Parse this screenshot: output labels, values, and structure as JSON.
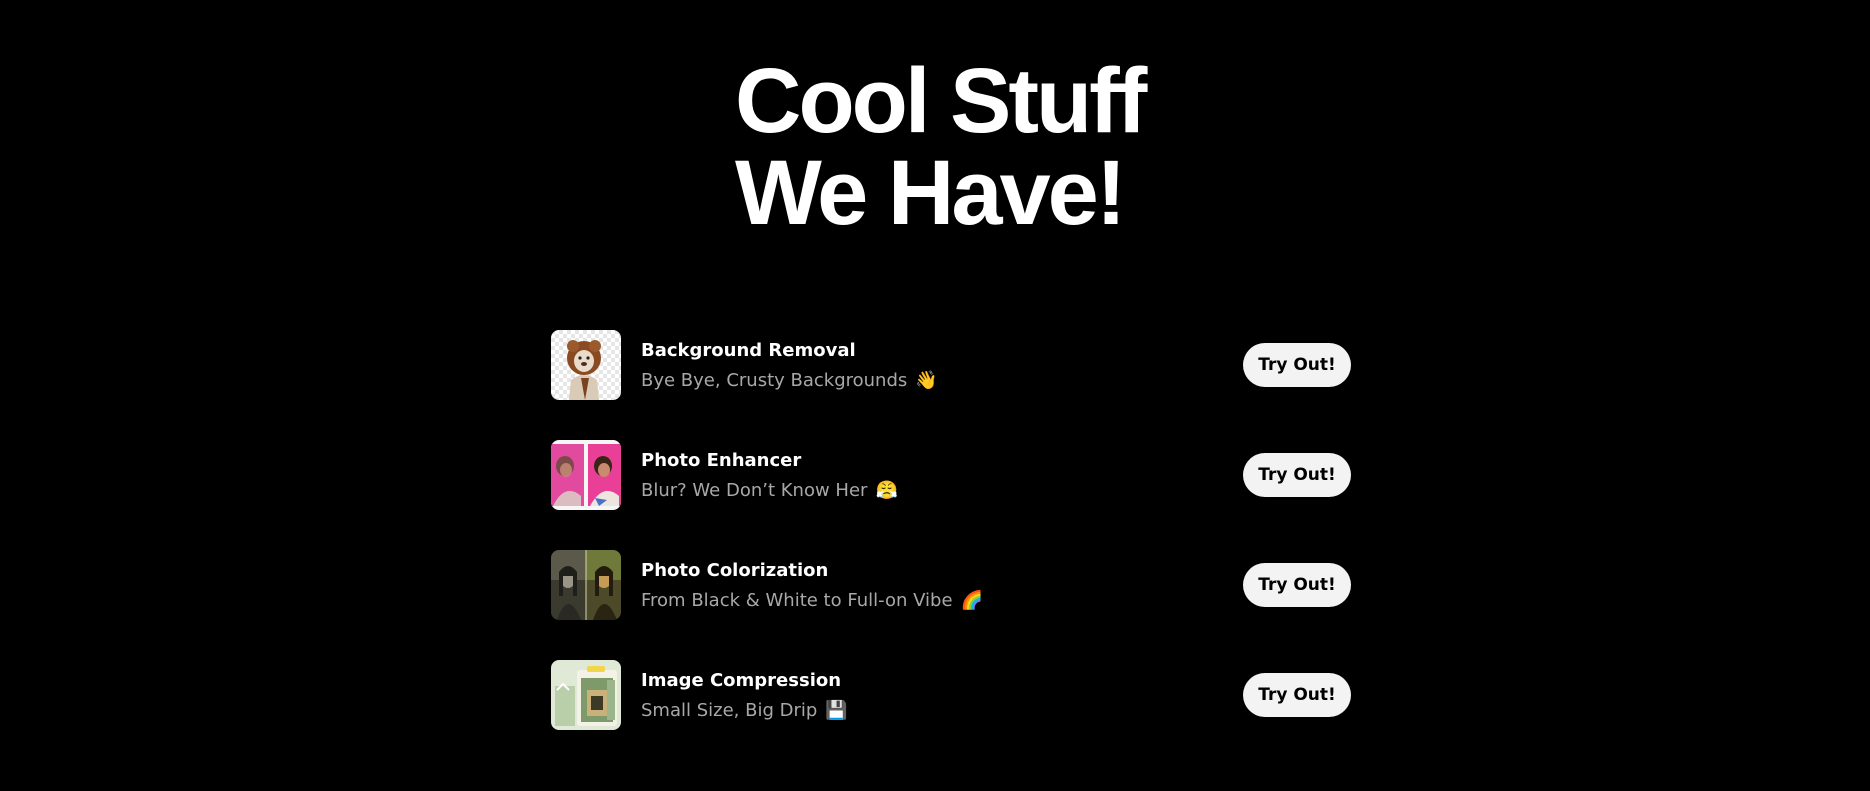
{
  "hero": {
    "line1": "Cool Stuff",
    "line2": "We Have!"
  },
  "tools": [
    {
      "title": "Background Removal",
      "subtitle": "Bye Bye, Crusty Backgrounds",
      "emoji": "👋",
      "button": "Try Out!",
      "icon": "dog-in-lion-costume-thumbnail"
    },
    {
      "title": "Photo Enhancer",
      "subtitle": "Blur? We Don’t Know Her",
      "emoji": "😤",
      "button": "Try Out!",
      "icon": "portrait-before-after-thumbnail"
    },
    {
      "title": "Photo Colorization",
      "subtitle": "From Black & White to Full-on Vibe",
      "emoji": "🌈",
      "button": "Try Out!",
      "icon": "mona-lisa-split-thumbnail"
    },
    {
      "title": "Image Compression",
      "subtitle": "Small Size, Big Drip",
      "emoji": "💾",
      "button": "Try Out!",
      "icon": "compressed-image-thumbnail"
    }
  ],
  "colors": {
    "background": "#000000",
    "title": "#ffffff",
    "subtitle": "#a8a8a8",
    "button_bg": "#f3f3f3",
    "button_text": "#000000"
  }
}
